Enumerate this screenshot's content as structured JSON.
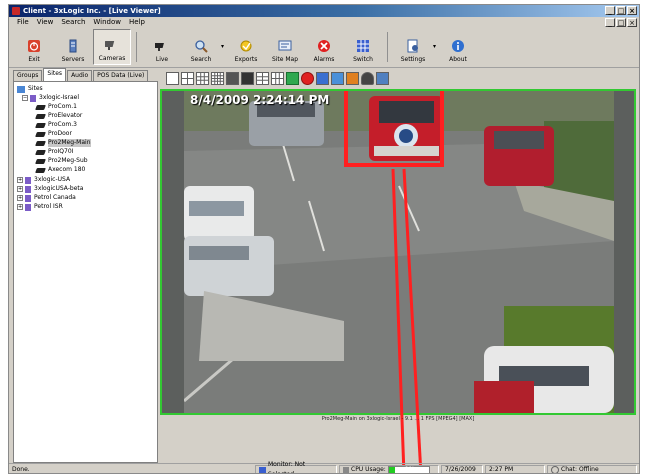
{
  "window": {
    "title": "Client - 3xLogic Inc. - [Live Viewer]"
  },
  "menu": [
    "File",
    "View",
    "Search",
    "Window",
    "Help"
  ],
  "toolbar": {
    "exit": "Exit",
    "servers": "Servers",
    "cameras": "Cameras",
    "live": "Live",
    "search": "Search",
    "exports": "Exports",
    "sitemap": "Site Map",
    "alarms": "Alarms",
    "switch": "Switch",
    "settings": "Settings",
    "about": "About"
  },
  "tabs": [
    "Groups",
    "Sites",
    "Audio",
    "POS Data (Live)"
  ],
  "tree": {
    "root": "Sites",
    "site": "3xlogic-Israel",
    "cameras": [
      "ProCom.1",
      "ProElevator",
      "ProCom.3",
      "ProDoor",
      "Pro2Meg-Main",
      "ProIQ70I",
      "Pro2Meg-Sub",
      "Axecom 180"
    ],
    "others": [
      "3xlogic-USA",
      "3xlogicUSA-beta",
      "Petrol Canada",
      "Petrol ISR"
    ]
  },
  "video": {
    "timestamp": "8/4/2009 2:24:14 PM",
    "caption": "Pro2Meg-Main on 3xlogic-Israel - 9.1 ... 1 FPS [MPEG4] [MAX]"
  },
  "status": {
    "ready": "Done.",
    "monitor": "Monitor: Not Selected",
    "cpu": "CPU Usage:",
    "cpu_value": "1%",
    "cpu_fraction": 0.15,
    "date": "7/26/2009",
    "time": "2:27 PM",
    "chat": "Chat: Offline"
  },
  "colors": {
    "selection": "#ff2020",
    "active_frame": "#32c832",
    "title_start": "#0a246a"
  }
}
